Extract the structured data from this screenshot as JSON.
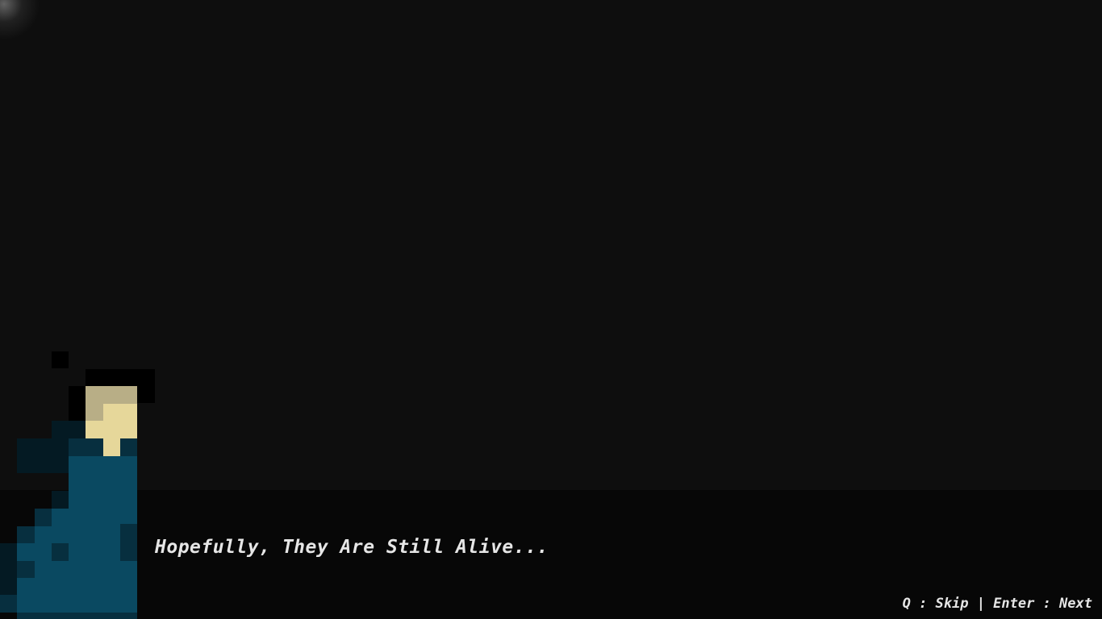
{
  "dialog": {
    "text": "Hopefully, They Are Still Alive..."
  },
  "controls": {
    "hint": "Q : Skip | Enter : Next"
  },
  "colors": {
    "background": "#0e0e0e",
    "dialog_box": "#070707",
    "text": "#e6e6e6",
    "skin_light": "#e6d79a",
    "skin_shadow": "#b8ae86",
    "cloak": "#0a4961",
    "cloak_shadow": "#072f3f",
    "cloak_dark": "#041a23"
  }
}
